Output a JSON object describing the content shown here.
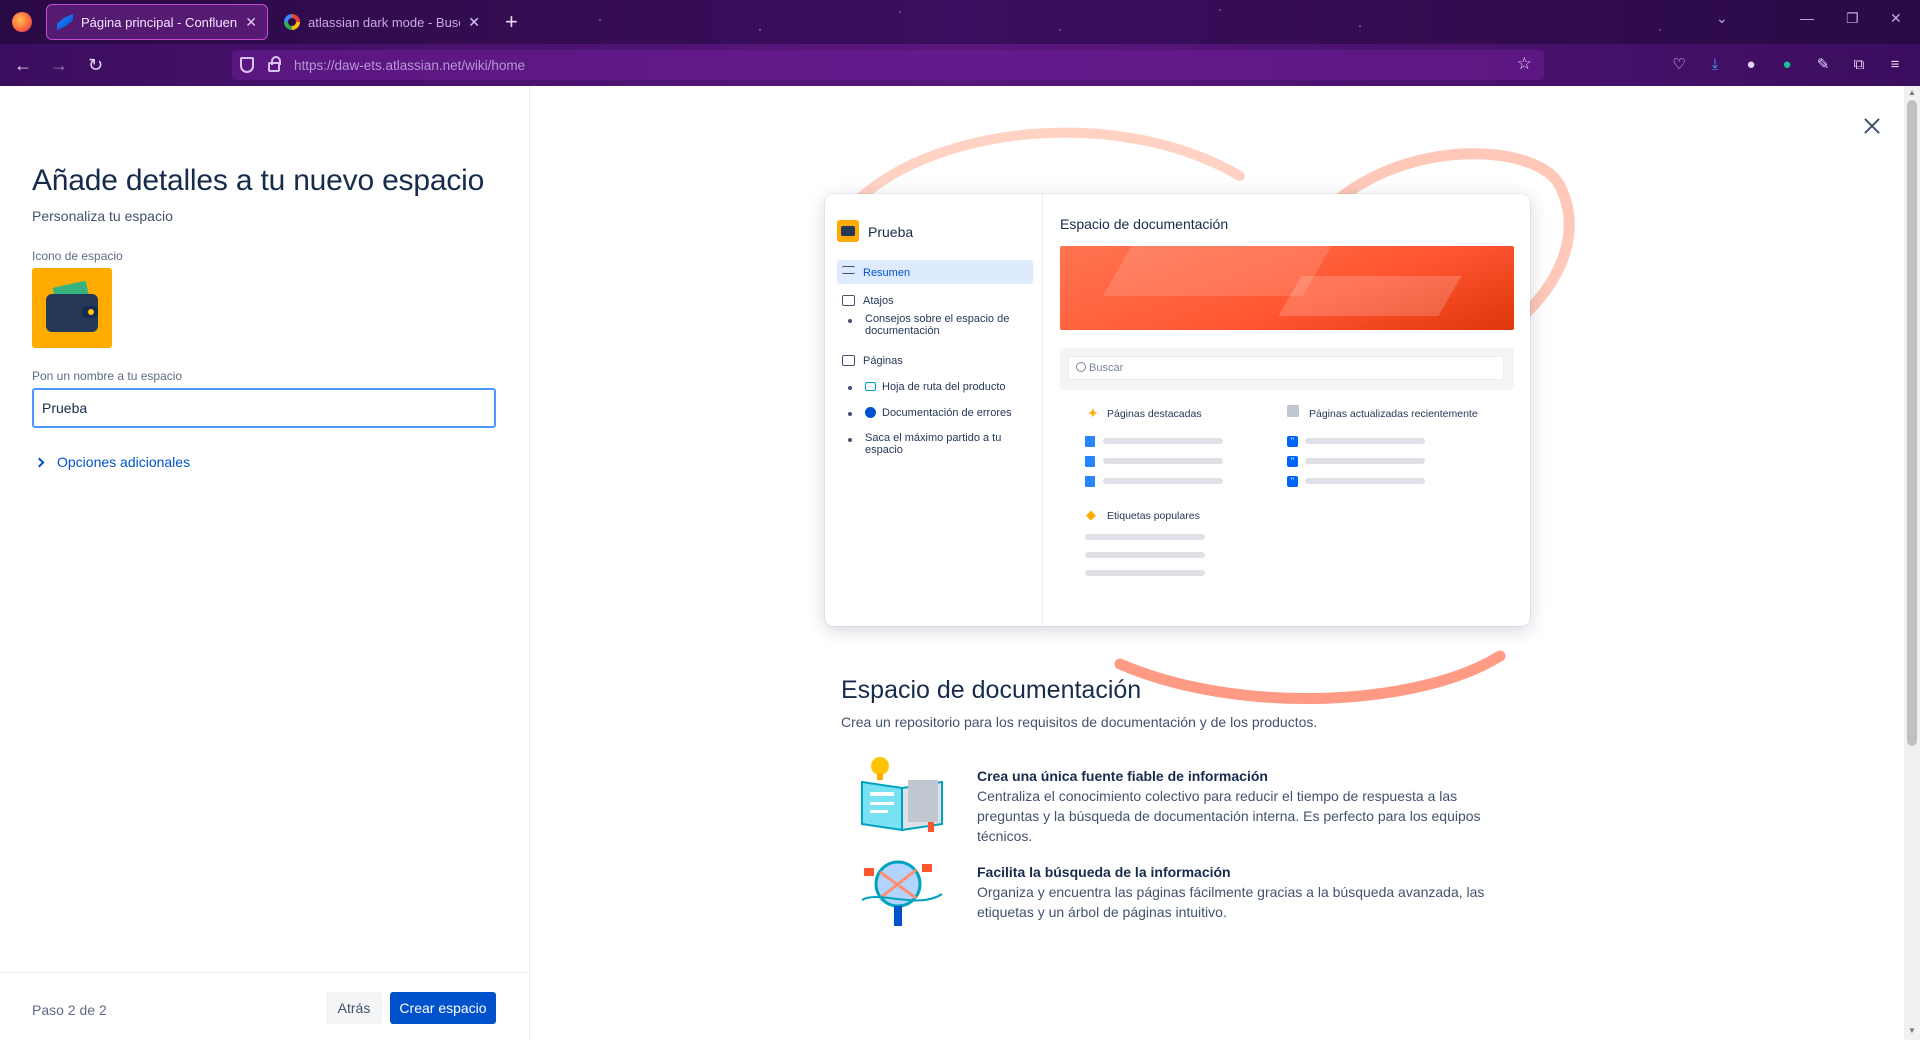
{
  "browser": {
    "tabs": [
      {
        "title": "Página principal - Confluence",
        "icon": "confluence-icon",
        "active": true
      },
      {
        "title": "atlassian dark mode - Buscar c",
        "icon": "google-icon",
        "active": false
      }
    ],
    "url": "https://daw-ets.atlassian.net/wiki/home"
  },
  "form": {
    "title": "Añade detalles a tu nuevo espacio",
    "subtitle": "Personaliza tu espacio",
    "icon_label": "Icono de espacio",
    "name_label": "Pon un nombre a tu espacio",
    "name_value": "Prueba",
    "more_options": "Opciones adicionales",
    "step": "Paso 2 de 2",
    "back_button": "Atrás",
    "create_button": "Crear espacio"
  },
  "preview": {
    "space_name": "Prueba",
    "nav": {
      "resumen": "Resumen",
      "atajos": "Atajos",
      "atajos_tip": "Consejos sobre el espacio de documentación",
      "paginas": "Páginas",
      "page1": "Hoja de ruta del producto",
      "page2": "Documentación de errores",
      "page3": "Saca el máximo partido a tu espacio"
    },
    "main_title": "Espacio de documentación",
    "search_placeholder": "Buscar",
    "featured": "Páginas destacadas",
    "recent": "Páginas actualizadas recientemente",
    "labels": "Etiquetas populares"
  },
  "template": {
    "title": "Espacio de documentación",
    "description": "Crea un repositorio para los requisitos de documentación y de los productos.",
    "features": [
      {
        "title": "Crea una única fuente fiable de información",
        "body": "Centraliza el conocimiento colectivo para reducir el tiempo de respuesta a las preguntas y la búsqueda de documentación interna. Es perfecto para los equipos técnicos."
      },
      {
        "title": "Facilita la búsqueda de la información",
        "body": "Organiza y encuentra las páginas fácilmente gracias a la búsqueda avanzada, las etiquetas y un árbol de páginas intuitivo."
      }
    ]
  },
  "colors": {
    "primary": "#0052cc",
    "input_focus": "#4c9aff",
    "space_icon_bg": "#ffab00",
    "banner": "#ff5630"
  }
}
